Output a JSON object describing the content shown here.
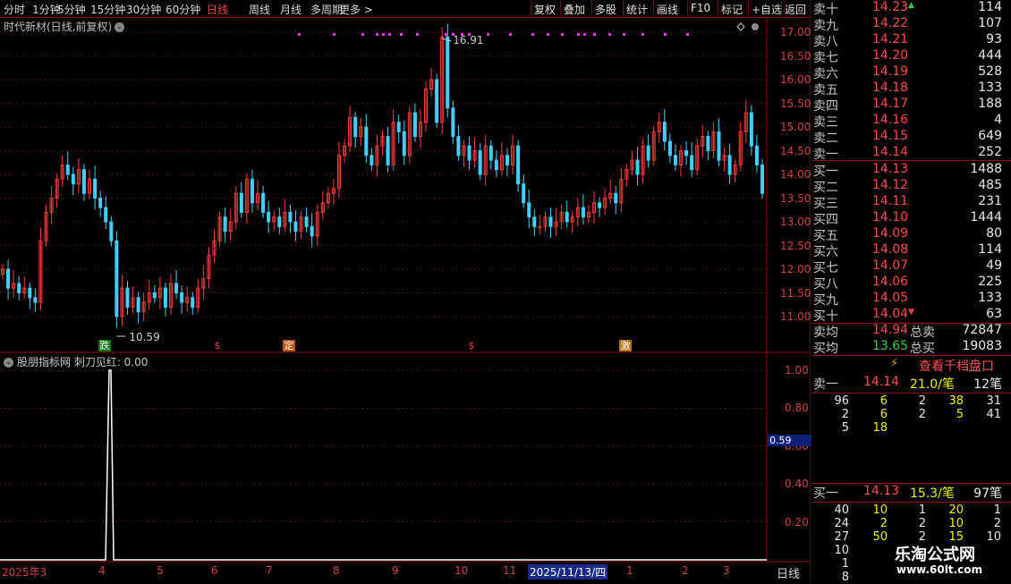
{
  "toolbar": {
    "periods": [
      "分时",
      "1分钟",
      "5分钟",
      "15分钟",
      "30分钟",
      "60分钟",
      "日线",
      "周线",
      "月线",
      "多周期",
      "更多 >"
    ],
    "active_period": "日线",
    "right_buttons": [
      "复权",
      "叠加",
      "多股",
      "统计",
      "画线",
      "F10",
      "标记",
      "+自选",
      "返回"
    ]
  },
  "main_chart": {
    "title": "时代新材(日线,前复权)",
    "y_ticks": [
      "17.00",
      "16.50",
      "16.00",
      "15.50",
      "15.00",
      "14.50",
      "14.00",
      "13.50",
      "13.00",
      "12.50",
      "12.00",
      "11.50",
      "11.00"
    ],
    "high_label": "16.91",
    "low_label": "10.59",
    "signals": [
      "跌",
      "$",
      "定",
      "$",
      "激"
    ]
  },
  "indicator": {
    "title": "股朋指标网 刺刀见红: 0.00",
    "y_ticks": [
      "1.00",
      "0.80",
      "0.60",
      "0.40",
      "0.20"
    ],
    "current_value": "0.59"
  },
  "x_axis": {
    "labels": [
      "2025年3",
      "4",
      "5",
      "6",
      "7",
      "8",
      "9",
      "10",
      "11",
      "2025/11/13/四",
      "1",
      "2",
      "3"
    ],
    "period_label": "日线"
  },
  "order_book": {
    "asks": [
      {
        "label": "卖十",
        "price": "14.23",
        "qty": "114",
        "arrow": "up"
      },
      {
        "label": "卖九",
        "price": "14.22",
        "qty": "107"
      },
      {
        "label": "卖八",
        "price": "14.21",
        "qty": "93"
      },
      {
        "label": "卖七",
        "price": "14.20",
        "qty": "444"
      },
      {
        "label": "卖六",
        "price": "14.19",
        "qty": "528"
      },
      {
        "label": "卖五",
        "price": "14.18",
        "qty": "133"
      },
      {
        "label": "卖四",
        "price": "14.17",
        "qty": "188"
      },
      {
        "label": "卖三",
        "price": "14.16",
        "qty": "4"
      },
      {
        "label": "卖二",
        "price": "14.15",
        "qty": "649"
      },
      {
        "label": "卖一",
        "price": "14.14",
        "qty": "252"
      }
    ],
    "bids": [
      {
        "label": "买一",
        "price": "14.13",
        "qty": "1488"
      },
      {
        "label": "买二",
        "price": "14.12",
        "qty": "485"
      },
      {
        "label": "买三",
        "price": "14.11",
        "qty": "231"
      },
      {
        "label": "买四",
        "price": "14.10",
        "qty": "1444"
      },
      {
        "label": "买五",
        "price": "14.09",
        "qty": "80"
      },
      {
        "label": "买六",
        "price": "14.08",
        "qty": "114"
      },
      {
        "label": "买七",
        "price": "14.07",
        "qty": "49"
      },
      {
        "label": "买八",
        "price": "14.06",
        "qty": "225"
      },
      {
        "label": "买九",
        "price": "14.05",
        "qty": "133"
      },
      {
        "label": "买十",
        "price": "14.04",
        "qty": "63",
        "arrow": "down"
      }
    ],
    "summary": [
      {
        "label": "卖均",
        "price": "14.94",
        "label2": "总卖",
        "qty": "72847",
        "color": "#ff4a4a"
      },
      {
        "label": "买均",
        "price": "13.65",
        "label2": "总买",
        "qty": "19083",
        "color": "#30d040"
      }
    ],
    "deep_book_button": "查看千档盘口",
    "sell_queue": {
      "label": "卖一",
      "price": "14.14",
      "avg": "21.0/笔",
      "count": "12笔",
      "rows": [
        [
          "96",
          "6",
          "2",
          "38",
          "31"
        ],
        [
          "2",
          "6",
          "2",
          "5",
          "41"
        ],
        [
          "5",
          "18",
          "",
          "",
          ""
        ]
      ]
    },
    "buy_queue": {
      "label": "买一",
      "price": "14.13",
      "avg": "15.3/笔",
      "count": "97笔",
      "rows": [
        [
          "40",
          "10",
          "1",
          "20",
          "1"
        ],
        [
          "24",
          "2",
          "2",
          "10",
          "2"
        ],
        [
          "27",
          "50",
          "2",
          "15",
          "10"
        ],
        [
          "10",
          "",
          "",
          "",
          ""
        ],
        [
          "1",
          "",
          "",
          "",
          ""
        ],
        [
          "8",
          "",
          "",
          "",
          ""
        ]
      ]
    }
  },
  "watermark": {
    "line1": "乐淘公式网",
    "line2": "www.60lt.com"
  },
  "colors": {
    "up": "#ff3c3c",
    "down": "#40d0ff",
    "grid": "#8a1010",
    "signal": "#ff30ff"
  }
}
